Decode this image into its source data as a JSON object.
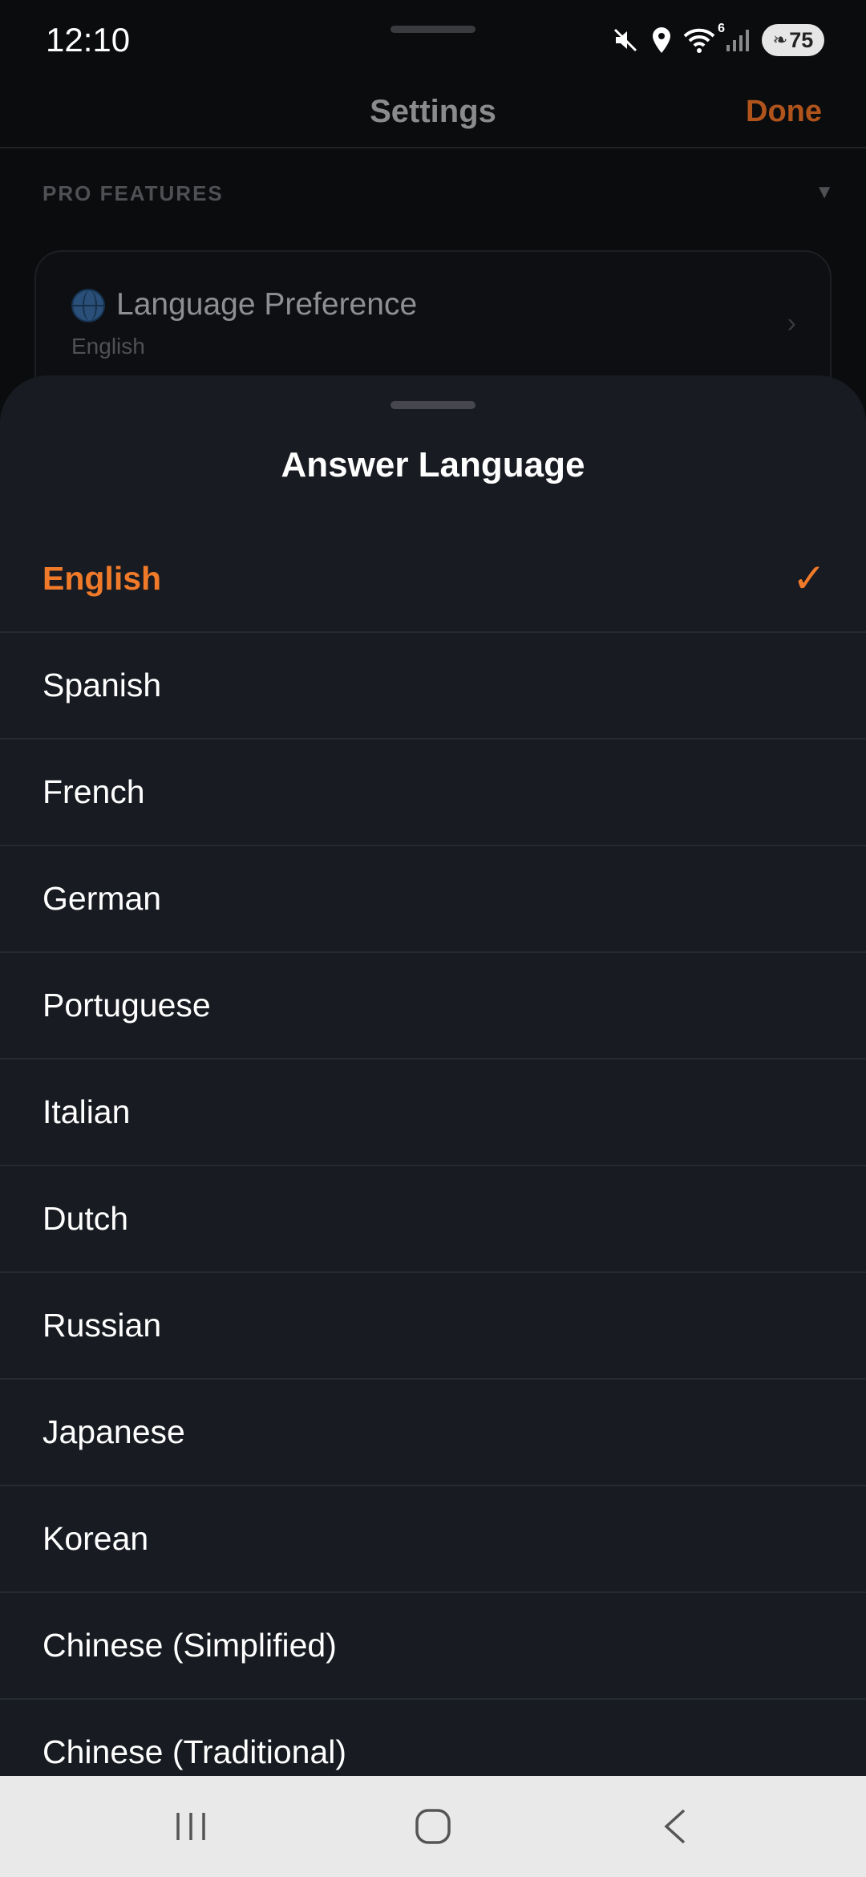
{
  "status_bar": {
    "time": "12:10",
    "wifi_badge": "6",
    "battery": "75",
    "icons": [
      "mute-icon",
      "location-icon",
      "wifi-icon",
      "signal-icon",
      "battery-icon"
    ]
  },
  "nav": {
    "title": "Settings",
    "done_label": "Done"
  },
  "section": {
    "header": "PRO FEATURES",
    "caret": "▼"
  },
  "preference": {
    "title": "Language Preference",
    "value": "English",
    "chevron": "›"
  },
  "sheet": {
    "title": "Answer Language",
    "check": "✓",
    "selected_index": 0,
    "items": [
      {
        "label": "English"
      },
      {
        "label": "Spanish"
      },
      {
        "label": "French"
      },
      {
        "label": "German"
      },
      {
        "label": "Portuguese"
      },
      {
        "label": "Italian"
      },
      {
        "label": "Dutch"
      },
      {
        "label": "Russian"
      },
      {
        "label": "Japanese"
      },
      {
        "label": "Korean"
      },
      {
        "label": "Chinese (Simplified)"
      },
      {
        "label": "Chinese (Traditional)"
      }
    ]
  },
  "colors": {
    "accent": "#f07a2a",
    "sheet_bg": "#181b21",
    "screen_bg": "#0b0c0e",
    "sys_nav_bg": "#e8e9e8"
  }
}
